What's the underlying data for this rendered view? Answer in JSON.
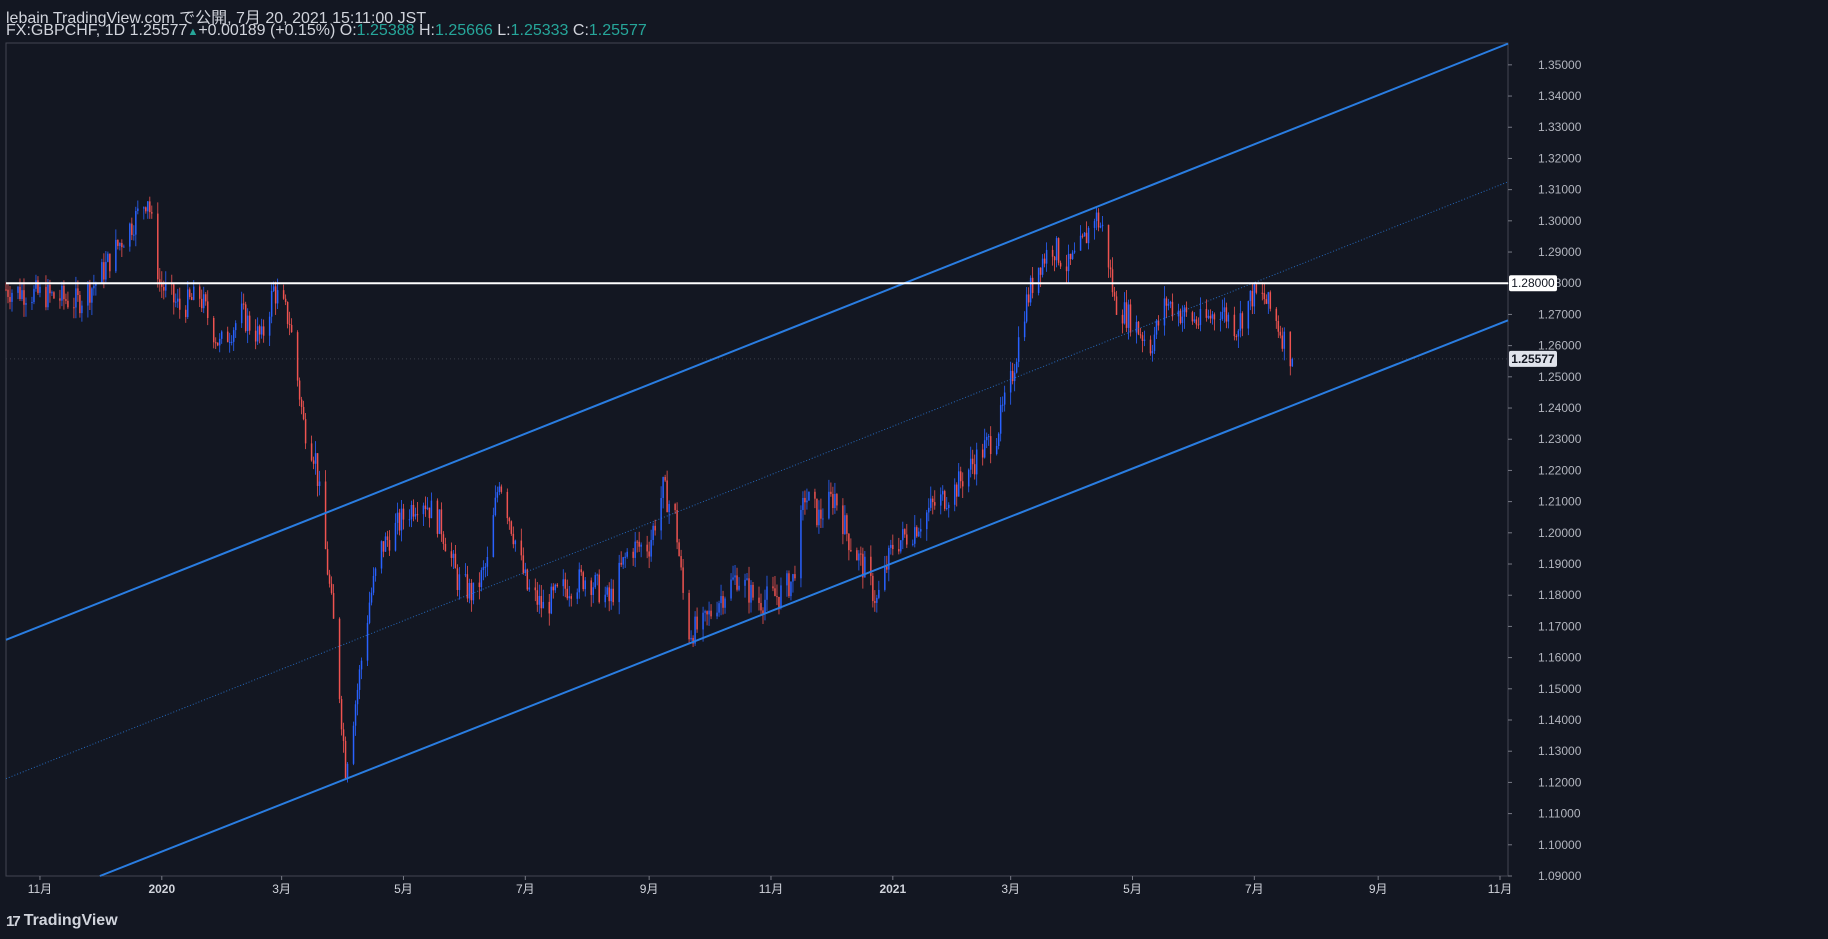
{
  "header": {
    "publisher": "lebain TradingView.com で公開, 7月 20, 2021 15:11:00 JST",
    "symbol": "FX:GBPCHF, 1D",
    "last": "1.25577",
    "change": "+0.00189 (+0.15%)",
    "o_label": "O:",
    "o_value": "1.25388",
    "h_label": "H:",
    "h_value": "1.25666",
    "l_label": "L:",
    "l_value": "1.25333",
    "c_label": "C:",
    "c_value": "1.25577"
  },
  "footer": {
    "brand": "TradingView"
  },
  "colors": {
    "background": "#131722",
    "up_candle": "#2962ff",
    "down_candle": "#ef5350",
    "channel_line": "#2a7de1",
    "horizontal_line": "#ffffff",
    "price_label_bg": "#ffffff"
  },
  "chart_data": {
    "type": "candlestick",
    "symbol": "FX:GBPCHF",
    "timeframe": "1D",
    "y_ticks": [
      "1.35000",
      "1.34000",
      "1.33000",
      "1.32000",
      "1.31000",
      "1.30000",
      "1.29000",
      "1.28000",
      "1.27000",
      "1.26000",
      "1.25000",
      "1.24000",
      "1.23000",
      "1.22000",
      "1.21000",
      "1.20000",
      "1.19000",
      "1.18000",
      "1.17000",
      "1.16000",
      "1.15000",
      "1.14000",
      "1.13000",
      "1.12000",
      "1.11000",
      "1.10000",
      "1.09000"
    ],
    "ylim": [
      1.09,
      1.357
    ],
    "x_ticks": [
      {
        "label": "11月",
        "date": "2019-11-01"
      },
      {
        "label": "2020",
        "date": "2020-01-01"
      },
      {
        "label": "3月",
        "date": "2020-03-01"
      },
      {
        "label": "5月",
        "date": "2020-05-01"
      },
      {
        "label": "7月",
        "date": "2020-07-01"
      },
      {
        "label": "9月",
        "date": "2020-09-01"
      },
      {
        "label": "11月",
        "date": "2020-11-01"
      },
      {
        "label": "2021",
        "date": "2021-01-01"
      },
      {
        "label": "3月",
        "date": "2021-03-01"
      },
      {
        "label": "5月",
        "date": "2021-05-01"
      },
      {
        "label": "7月",
        "date": "2021-07-01"
      },
      {
        "label": "9月",
        "date": "2021-09-01"
      },
      {
        "label": "11月",
        "date": "2021-11-01"
      }
    ],
    "xlim": [
      "2019-10-15",
      "2021-11-05"
    ],
    "horizontal_line": {
      "price": 1.28,
      "label": "1.28000"
    },
    "last_price": {
      "price": 1.25577,
      "label": "1.25577"
    },
    "channel": {
      "upper": [
        [
          "2019-10-15",
          1.1657
        ],
        [
          "2021-11-05",
          1.3568
        ]
      ],
      "lower": [
        [
          "2019-12-01",
          1.09
        ],
        [
          "2021-11-05",
          1.2681
        ]
      ],
      "middle": [
        [
          "2019-10-15",
          1.1212
        ],
        [
          "2021-11-05",
          1.3125
        ]
      ]
    },
    "price_path": [
      [
        "2019-10-15",
        1.278
      ],
      [
        "2019-11-05",
        1.276
      ],
      [
        "2019-11-20",
        1.274
      ],
      [
        "2019-11-30",
        1.281
      ],
      [
        "2019-12-10",
        1.292
      ],
      [
        "2019-12-20",
        1.302
      ],
      [
        "2019-12-25",
        1.308
      ],
      [
        "2019-12-31",
        1.28
      ],
      [
        "2020-01-10",
        1.272
      ],
      [
        "2020-01-20",
        1.276
      ],
      [
        "2020-01-30",
        1.26
      ],
      [
        "2020-02-10",
        1.27
      ],
      [
        "2020-02-20",
        1.262
      ],
      [
        "2020-02-26",
        1.278
      ],
      [
        "2020-03-05",
        1.268
      ],
      [
        "2020-03-12",
        1.235
      ],
      [
        "2020-03-18",
        1.224
      ],
      [
        "2020-03-22",
        1.2
      ],
      [
        "2020-03-28",
        1.165
      ],
      [
        "2020-04-02",
        1.125
      ],
      [
        "2020-04-08",
        1.15
      ],
      [
        "2020-04-14",
        1.178
      ],
      [
        "2020-04-20",
        1.195
      ],
      [
        "2020-05-01",
        1.205
      ],
      [
        "2020-05-10",
        1.212
      ],
      [
        "2020-05-20",
        1.202
      ],
      [
        "2020-05-28",
        1.185
      ],
      [
        "2020-06-05",
        1.18
      ],
      [
        "2020-06-12",
        1.19
      ],
      [
        "2020-06-18",
        1.218
      ],
      [
        "2020-06-25",
        1.2
      ],
      [
        "2020-07-02",
        1.182
      ],
      [
        "2020-07-10",
        1.176
      ],
      [
        "2020-07-20",
        1.182
      ],
      [
        "2020-08-01",
        1.186
      ],
      [
        "2020-08-12",
        1.178
      ],
      [
        "2020-08-22",
        1.195
      ],
      [
        "2020-09-01",
        1.196
      ],
      [
        "2020-09-08",
        1.214
      ],
      [
        "2020-09-14",
        1.205
      ],
      [
        "2020-09-20",
        1.168
      ],
      [
        "2020-09-28",
        1.17
      ],
      [
        "2020-10-05",
        1.178
      ],
      [
        "2020-10-15",
        1.186
      ],
      [
        "2020-10-25",
        1.178
      ],
      [
        "2020-11-05",
        1.18
      ],
      [
        "2020-11-12",
        1.185
      ],
      [
        "2020-11-18",
        1.212
      ],
      [
        "2020-11-25",
        1.205
      ],
      [
        "2020-12-03",
        1.212
      ],
      [
        "2020-12-10",
        1.198
      ],
      [
        "2020-12-18",
        1.188
      ],
      [
        "2020-12-24",
        1.178
      ],
      [
        "2021-01-01",
        1.196
      ],
      [
        "2021-01-10",
        1.2
      ],
      [
        "2021-01-20",
        1.208
      ],
      [
        "2021-02-01",
        1.214
      ],
      [
        "2021-02-12",
        1.224
      ],
      [
        "2021-02-22",
        1.232
      ],
      [
        "2021-03-01",
        1.248
      ],
      [
        "2021-03-08",
        1.272
      ],
      [
        "2021-03-15",
        1.286
      ],
      [
        "2021-03-22",
        1.292
      ],
      [
        "2021-03-30",
        1.285
      ],
      [
        "2021-04-06",
        1.292
      ],
      [
        "2021-04-12",
        1.302
      ],
      [
        "2021-04-17",
        1.296
      ],
      [
        "2021-04-22",
        1.274
      ],
      [
        "2021-05-01",
        1.268
      ],
      [
        "2021-05-10",
        1.26
      ],
      [
        "2021-05-18",
        1.274
      ],
      [
        "2021-05-26",
        1.27
      ],
      [
        "2021-06-05",
        1.267
      ],
      [
        "2021-06-14",
        1.272
      ],
      [
        "2021-06-22",
        1.266
      ],
      [
        "2021-06-30",
        1.276
      ],
      [
        "2021-07-06",
        1.275
      ],
      [
        "2021-07-12",
        1.268
      ],
      [
        "2021-07-20",
        1.2558
      ]
    ]
  }
}
